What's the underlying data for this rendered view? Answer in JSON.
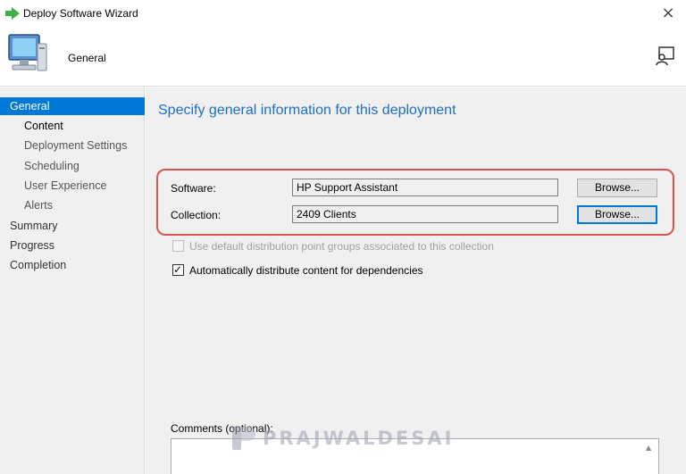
{
  "window": {
    "title": "Deploy Software Wizard",
    "close_glyph": "×"
  },
  "header": {
    "title": "General"
  },
  "sidebar": {
    "items": [
      {
        "label": "General",
        "level": "top",
        "active": true
      },
      {
        "label": "Content",
        "level": "sub",
        "active": false
      },
      {
        "label": "Deployment Settings",
        "level": "sub",
        "active": false
      },
      {
        "label": "Scheduling",
        "level": "sub",
        "active": false
      },
      {
        "label": "User Experience",
        "level": "sub",
        "active": false
      },
      {
        "label": "Alerts",
        "level": "sub",
        "active": false
      },
      {
        "label": "Summary",
        "level": "top",
        "active": false
      },
      {
        "label": "Progress",
        "level": "top",
        "active": false
      },
      {
        "label": "Completion",
        "level": "top",
        "active": false
      }
    ]
  },
  "main": {
    "heading": "Specify general information for this deployment",
    "software": {
      "label": "Software:",
      "value": "HP Support Assistant",
      "browse_label": "Browse..."
    },
    "collection": {
      "label": "Collection:",
      "value": "2409 Clients",
      "browse_label": "Browse..."
    },
    "options": {
      "use_default_dp": {
        "label": "Use default distribution point groups associated to this collection",
        "checked": false,
        "enabled": false
      },
      "auto_distribute": {
        "label": "Automatically distribute content for dependencies",
        "checked": true,
        "enabled": true
      }
    },
    "comments": {
      "label": "Comments (optional):",
      "value": ""
    }
  },
  "watermark": {
    "text": "PRAJWALDESAI"
  },
  "colors": {
    "accent": "#0078d7",
    "heading": "#1f6fbf",
    "highlight": "#e05252",
    "panel": "#f0f0f0"
  },
  "icons": {
    "title": "green-arrow-icon",
    "header": "computer-icon",
    "help": "help-person-icon"
  }
}
